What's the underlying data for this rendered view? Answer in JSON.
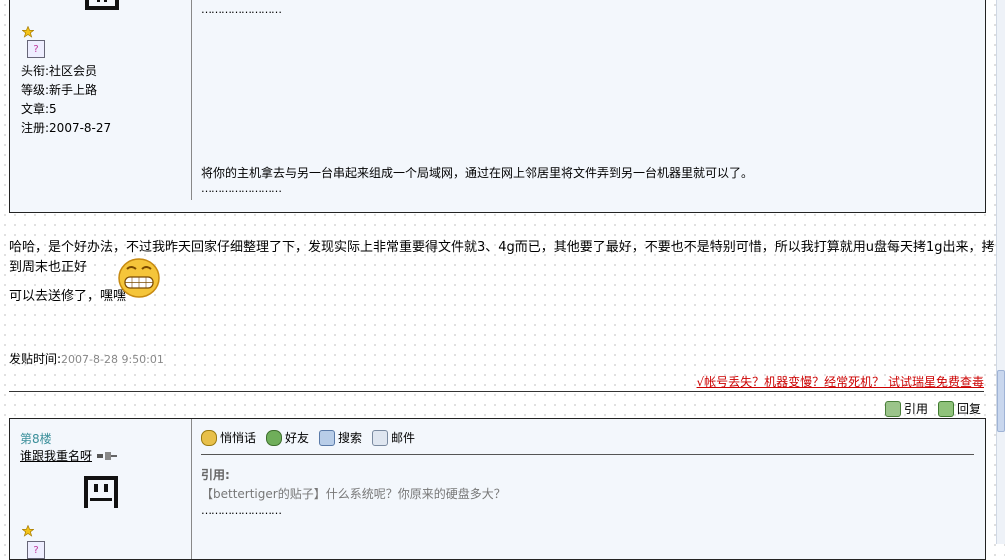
{
  "top_post": {
    "user": {
      "title": "头衔:社区会员",
      "level": "等级:新手上路",
      "posts": "文章:5",
      "registered": "注册:2007-8-27"
    },
    "dots_top": "……………………",
    "message": "将你的主机拿去与另一台串起来组成一个局域网，通过在网上邻居里将文件弄到另一台机器里就可以了。",
    "dots_bottom": "……………………"
  },
  "reply": {
    "line1": "哈哈，是个好办法，不过我昨天回家仔细整理了下，发现实际上非常重要得文件就3、4g而已，其他要了最好，不要也不是特别可惜，所以我打算就用u盘每天拷1g出来，拷到周末也正好",
    "line2": "可以去送修了，嘿嘿",
    "time_label": "发贴时间:",
    "time_value": "2007-8-28 9:50:01",
    "promo": "√帐号丢失？机器变慢？经常死机？ 试试瑞星免费查毒",
    "quote_btn": "引用",
    "reply_btn": "回复"
  },
  "bottom_post": {
    "floor": "第8楼",
    "username": "谁跟我重名呀",
    "toolbar": {
      "whisper": "悄悄话",
      "friend": "好友",
      "search": "搜索",
      "mail": "邮件"
    },
    "quote_label": "引用:",
    "quote_text": "【bettertiger的贴子】什么系统呢？你原来的硬盘多大？",
    "dots": "……………………"
  }
}
